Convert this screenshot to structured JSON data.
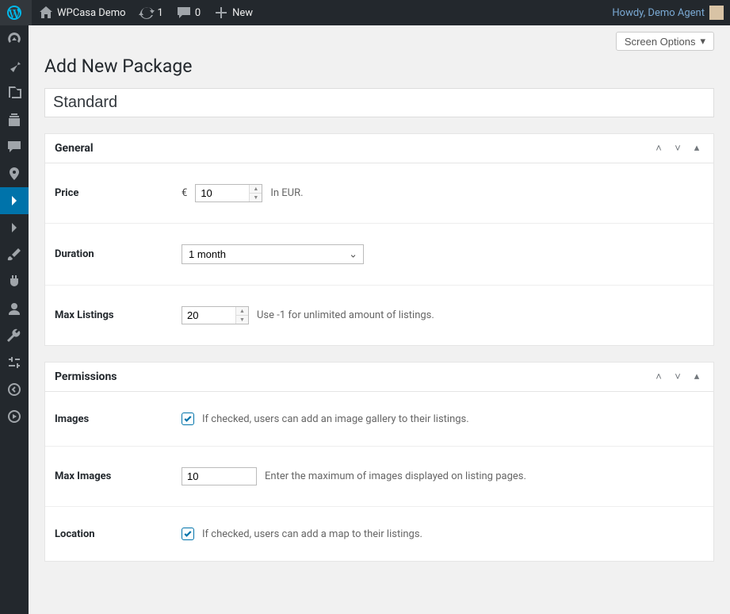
{
  "adminbar": {
    "site_name": "WPCasa Demo",
    "revisions": "1",
    "comments": "0",
    "new_label": "New",
    "howdy_prefix": "Howdy, ",
    "user_name": "Demo Agent"
  },
  "screen_options_label": "Screen Options",
  "page_title": "Add New Package",
  "title_value": "Standard",
  "panels": {
    "general": {
      "heading": "General",
      "price": {
        "label": "Price",
        "currency": "€",
        "value": "10",
        "hint": "In EUR."
      },
      "duration": {
        "label": "Duration",
        "value": "1 month"
      },
      "max_listings": {
        "label": "Max Listings",
        "value": "20",
        "hint": "Use -1 for unlimited amount of listings."
      }
    },
    "permissions": {
      "heading": "Permissions",
      "images": {
        "label": "Images",
        "checked": true,
        "hint": "If checked, users can add an image gallery to their listings."
      },
      "max_images": {
        "label": "Max Images",
        "value": "10",
        "hint": "Enter the maximum of images displayed on listing pages."
      },
      "location": {
        "label": "Location",
        "checked": true,
        "hint": "If checked, users can add a map to their listings."
      }
    }
  }
}
